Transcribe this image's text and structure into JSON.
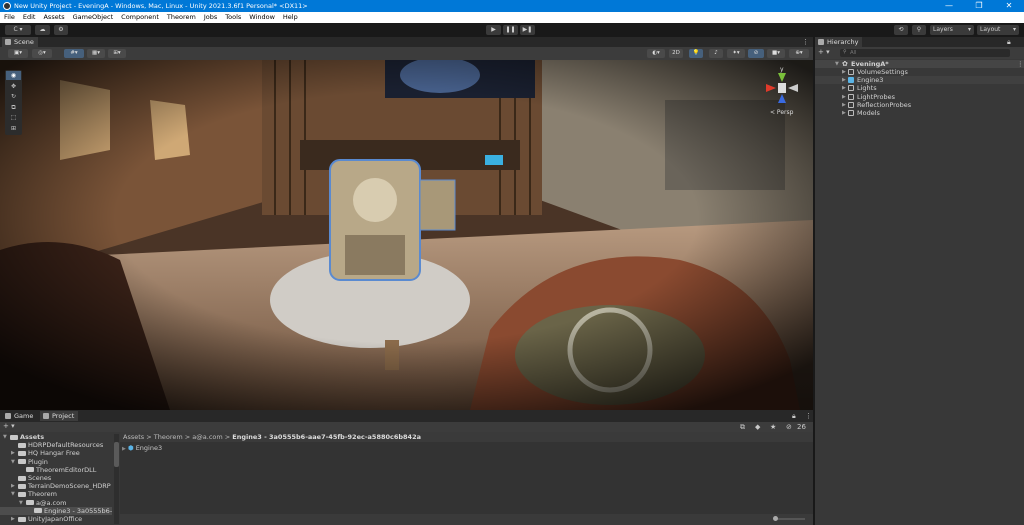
{
  "window": {
    "title": "New Unity Project - EveningA - Windows, Mac, Linux - Unity 2021.3.6f1 Personal* <DX11>",
    "minimize": "—",
    "maximize": "❐",
    "close": "✕"
  },
  "menu": [
    "File",
    "Edit",
    "Assets",
    "GameObject",
    "Component",
    "Theorem",
    "Jobs",
    "Tools",
    "Window",
    "Help"
  ],
  "toolbar": {
    "account": "C ▾",
    "play": "▶",
    "pause": "❚❚",
    "step": "▶❚",
    "layers": "Layers",
    "layout": "Layout"
  },
  "scene": {
    "tab": "Scene",
    "mode_2d": "2D",
    "persp": "< Persp",
    "gizmo_y": "y",
    "menu": "⋮"
  },
  "hierarchy": {
    "tab": "Hierarchy",
    "search_placeholder": "All",
    "add": "+ ▾",
    "root": "EveningA*",
    "items": [
      "VolumeSettings",
      "Engine3",
      "Lights",
      "LightProbes",
      "ReflectionProbes",
      "Models"
    ]
  },
  "bottom": {
    "tabs": [
      "Game",
      "Project"
    ],
    "add": "+ ▾",
    "hidden_count": "26"
  },
  "project": {
    "tree": [
      {
        "label": "Assets",
        "depth": 0,
        "arrow": "▼",
        "bold": true
      },
      {
        "label": "HDRPDefaultResources",
        "depth": 1,
        "arrow": ""
      },
      {
        "label": "HQ Hangar Free",
        "depth": 1,
        "arrow": "▶"
      },
      {
        "label": "Plugin",
        "depth": 1,
        "arrow": "▼"
      },
      {
        "label": "TheoremEditorDLL",
        "depth": 2,
        "arrow": ""
      },
      {
        "label": "Scenes",
        "depth": 1,
        "arrow": ""
      },
      {
        "label": "TerrainDemoScene_HDRP",
        "depth": 1,
        "arrow": "▶"
      },
      {
        "label": "Theorem",
        "depth": 1,
        "arrow": "▼"
      },
      {
        "label": "a@a.com",
        "depth": 2,
        "arrow": "▼"
      },
      {
        "label": "Engine3 - 3a0555b6-aa",
        "depth": 3,
        "arrow": "",
        "selected": true
      },
      {
        "label": "UnityJapanOffice",
        "depth": 1,
        "arrow": "▶"
      }
    ],
    "breadcrumb": [
      "Assets",
      "Theorem",
      "a@a.com",
      "Engine3 - 3a0555b6-aae7-45fb-92ec-a5880c6b842a"
    ],
    "files": [
      "Engine3"
    ]
  },
  "colors": {
    "titlebar": "#0078d7",
    "selection": "#46607c",
    "prefab": "#5ab4e6"
  }
}
